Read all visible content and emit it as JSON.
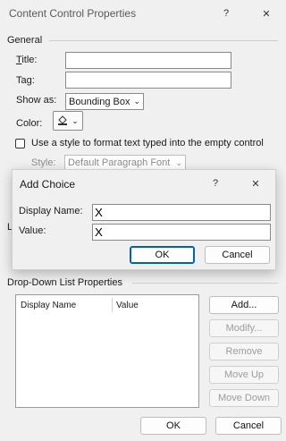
{
  "window": {
    "title": "Content Control Properties",
    "help_glyph": "?",
    "close_glyph": "✕"
  },
  "general": {
    "group_label": "General",
    "title_label": "Title:",
    "title_value": "",
    "tag_label": "Tag:",
    "tag_value": "",
    "show_as_label": "Show as:",
    "show_as_value": "Bounding Box",
    "color_label": "Color:",
    "style_checkbox_label": "Use a style to format text typed into the empty control",
    "style_label": "Style:",
    "style_value": "Default Paragraph Font"
  },
  "add_choice": {
    "title": "Add Choice",
    "help_glyph": "?",
    "close_glyph": "✕",
    "display_name_label": "Display Name:",
    "display_name_value": "X",
    "value_label": "Value:",
    "value_value": "X",
    "ok_label": "OK",
    "cancel_label": "Cancel"
  },
  "dropdown": {
    "group_label": "Drop-Down List Properties",
    "columns": [
      "Display Name",
      "Value"
    ],
    "buttons": {
      "add": "Add...",
      "modify": "Modify...",
      "remove": "Remove",
      "move_up": "Move Up",
      "move_down": "Move Down"
    }
  },
  "footer": {
    "ok_label": "OK",
    "cancel_label": "Cancel"
  },
  "hidden_fragments": {
    "l_letter": "L"
  },
  "colors": {
    "accent": "#005fb8",
    "window_bg": "#f0f0f0"
  }
}
